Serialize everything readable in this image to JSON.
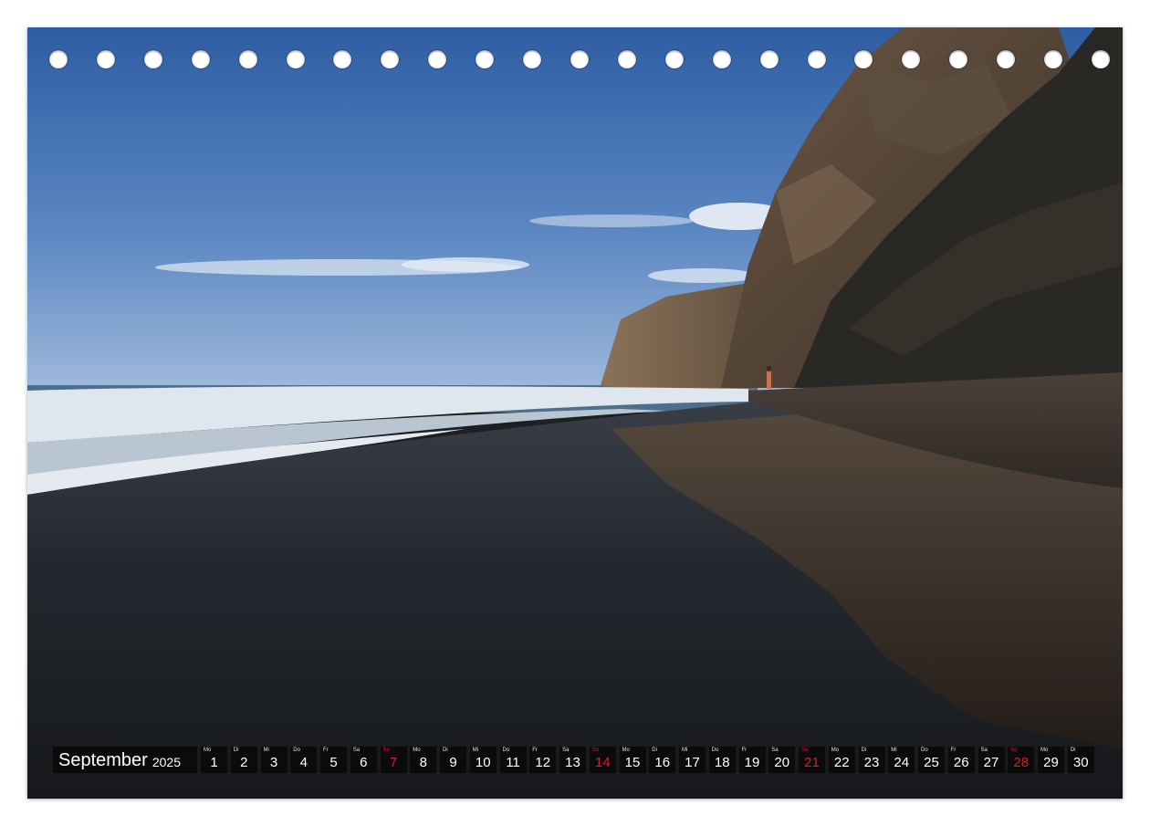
{
  "calendar": {
    "month": "September",
    "year": "2025",
    "sunday_color": "#d0202a",
    "days": [
      {
        "wd": "Mo",
        "d": "1"
      },
      {
        "wd": "Di",
        "d": "2"
      },
      {
        "wd": "Mi",
        "d": "3"
      },
      {
        "wd": "Do",
        "d": "4"
      },
      {
        "wd": "Fr",
        "d": "5"
      },
      {
        "wd": "Sa",
        "d": "6"
      },
      {
        "wd": "So",
        "d": "7",
        "sunday": true
      },
      {
        "wd": "Mo",
        "d": "8"
      },
      {
        "wd": "Di",
        "d": "9"
      },
      {
        "wd": "Mi",
        "d": "10"
      },
      {
        "wd": "Do",
        "d": "11"
      },
      {
        "wd": "Fr",
        "d": "12"
      },
      {
        "wd": "Sa",
        "d": "13"
      },
      {
        "wd": "So",
        "d": "14",
        "sunday": true
      },
      {
        "wd": "Mo",
        "d": "15"
      },
      {
        "wd": "Di",
        "d": "16"
      },
      {
        "wd": "Mi",
        "d": "17"
      },
      {
        "wd": "Do",
        "d": "18"
      },
      {
        "wd": "Fr",
        "d": "19"
      },
      {
        "wd": "Sa",
        "d": "20"
      },
      {
        "wd": "So",
        "d": "21",
        "sunday": true
      },
      {
        "wd": "Mo",
        "d": "22"
      },
      {
        "wd": "Di",
        "d": "23"
      },
      {
        "wd": "Mi",
        "d": "24"
      },
      {
        "wd": "Do",
        "d": "25"
      },
      {
        "wd": "Fr",
        "d": "26"
      },
      {
        "wd": "Sa",
        "d": "27"
      },
      {
        "wd": "So",
        "d": "28",
        "sunday": true
      },
      {
        "wd": "Mo",
        "d": "29"
      },
      {
        "wd": "Di",
        "d": "30"
      }
    ]
  },
  "binding": {
    "hole_count": 23
  }
}
